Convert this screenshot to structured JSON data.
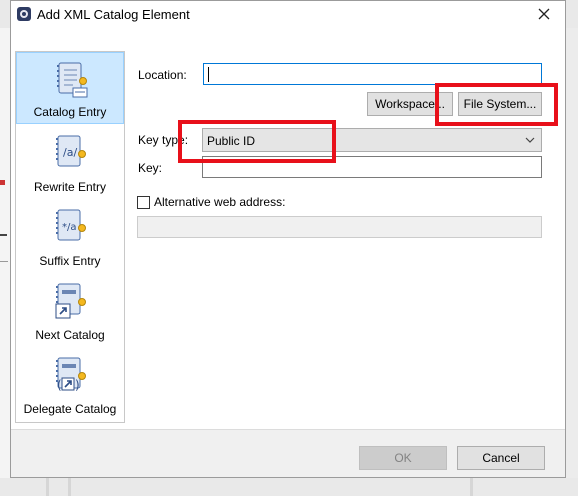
{
  "window": {
    "title": "Add XML Catalog Element"
  },
  "sidebar": {
    "items": [
      {
        "label": "Catalog Entry",
        "icon": "catalog-entry-icon",
        "selected": true
      },
      {
        "label": "Rewrite Entry",
        "icon": "rewrite-entry-icon",
        "selected": false
      },
      {
        "label": "Suffix Entry",
        "icon": "suffix-entry-icon",
        "selected": false
      },
      {
        "label": "Next Catalog",
        "icon": "next-catalog-icon",
        "selected": false
      },
      {
        "label": "Delegate Catalog",
        "icon": "delegate-catalog-icon",
        "selected": false
      }
    ]
  },
  "form": {
    "location_label": "Location:",
    "location_value": "",
    "workspace_button": "Workspace...",
    "file_system_button": "File System...",
    "key_type_label": "Key type:",
    "key_type_value": "Public ID",
    "key_label": "Key:",
    "key_value": "",
    "alt_web_label": "Alternative web address:",
    "alt_web_checked": false,
    "alt_web_value": ""
  },
  "footer": {
    "ok_label": "OK",
    "cancel_label": "Cancel",
    "ok_enabled": false
  },
  "colors": {
    "annotation": "#e8101a",
    "selection": "#cce8ff",
    "focus": "#0078d7"
  }
}
